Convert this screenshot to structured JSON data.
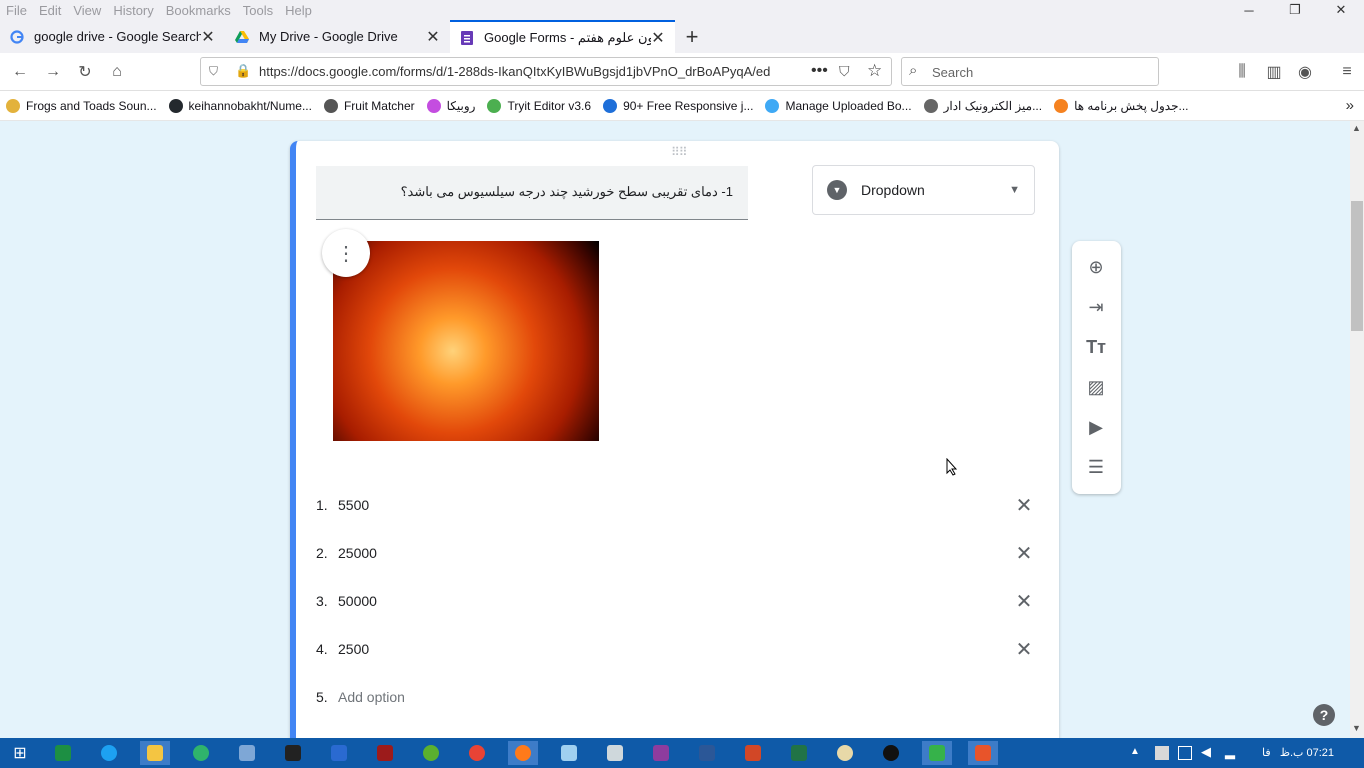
{
  "menubar": {
    "items": [
      "File",
      "Edit",
      "View",
      "History",
      "Bookmarks",
      "Tools",
      "Help"
    ]
  },
  "window_controls": {
    "minimize": "─",
    "restore": "❐",
    "close": "✕"
  },
  "tabs": [
    {
      "label": "google drive - Google Search",
      "icon": "google-icon"
    },
    {
      "label": "My Drive - Google Drive",
      "icon": "drive-icon"
    },
    {
      "label": "Google Forms - آزمون علوم هفتم",
      "icon": "forms-icon",
      "active": true
    }
  ],
  "nav": {
    "url": "https://docs.google.com/forms/d/1-288ds-IkanQItxKyIBWuBgsjd1jbVPnO_drBoAPyqA/ed",
    "search_placeholder": "Search"
  },
  "bookmarks": [
    {
      "label": "Frogs and Toads Soun...",
      "color": "#e3b23c"
    },
    {
      "label": "keihannobakht/Nume...",
      "color": "#24292e"
    },
    {
      "label": "Fruit Matcher",
      "color": "#555555"
    },
    {
      "label": "روبیکا",
      "color": "#c44de0"
    },
    {
      "label": "Tryit Editor v3.6",
      "color": "#4caf50"
    },
    {
      "label": "90+ Free Responsive j...",
      "color": "#1e6fd9"
    },
    {
      "label": "Manage Uploaded Bo...",
      "color": "#3fa9f5"
    },
    {
      "label": "میز الکترونیک ادار...",
      "color": "#666666"
    },
    {
      "label": "جدول پخش برنامه ها...",
      "color": "#f58220"
    }
  ],
  "form": {
    "question": "1- دمای تقریبی سطح خورشید چند درجه سیلسیوس می باشد؟",
    "question_type": "Dropdown",
    "options": [
      {
        "num": "1.",
        "value": "5500"
      },
      {
        "num": "2.",
        "value": "25000"
      },
      {
        "num": "3.",
        "value": "50000"
      },
      {
        "num": "4.",
        "value": "2500"
      }
    ],
    "add_option": {
      "num": "5.",
      "label": "Add option"
    },
    "help": "?"
  },
  "taskbar": {
    "clock": "07:21 ب.ظ",
    "lang": "فا"
  },
  "colors": {
    "accent": "#4285f4",
    "forms_purple": "#673ab7",
    "content_bg": "#e4f3fb",
    "taskbar": "#0f5aa8"
  }
}
